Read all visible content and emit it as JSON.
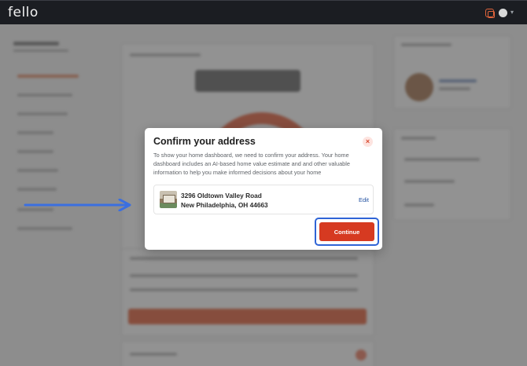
{
  "app": {
    "logo_text": "fello"
  },
  "modal": {
    "title": "Confirm your address",
    "close_glyph": "×",
    "description": "To show your home dashboard, we need to confirm your address. Your home dashboard includes an AI-based home value estimate and and other valuable information to help you make informed decisions about your home",
    "address_line1": "3296 Oldtown Valley Road",
    "address_line2": "New Philadelphia, OH 44663",
    "edit_label": "Edit",
    "continue_label": "Continue"
  },
  "colors": {
    "brand_accent": "#d63a21",
    "highlight_ring": "#2f64d6",
    "annotation_arrow": "#3b6fe0",
    "topbar": "#1b1d22"
  },
  "icons": {
    "top_right": [
      "notifications-icon",
      "avatar",
      "chevron-down-icon"
    ],
    "modal": [
      "close-icon",
      "house-thumbnail"
    ],
    "annotation": "arrow-right-icon"
  }
}
